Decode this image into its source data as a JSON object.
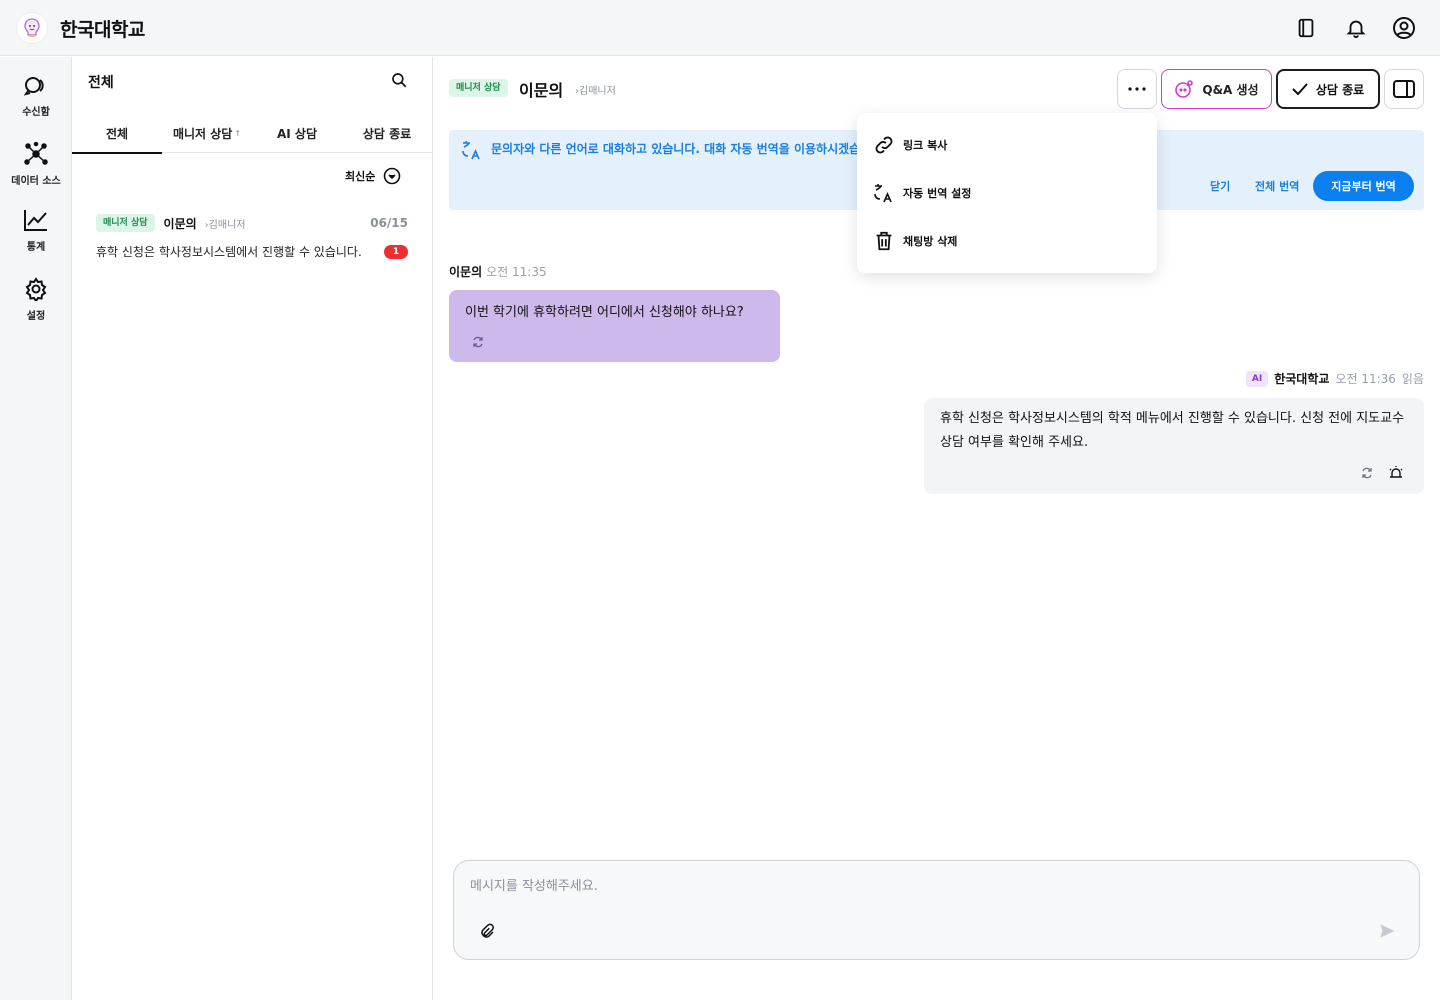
{
  "app": {
    "brand": "한국대학교",
    "accent_color": "#0a7ff0",
    "top_icons": [
      "book-icon",
      "bell-icon",
      "user-circle-icon"
    ]
  },
  "rail": {
    "items": [
      {
        "label": "수신함",
        "icon": "inbox-chat-icon"
      },
      {
        "label": "데이터 소스",
        "icon": "network-icon"
      },
      {
        "label": "통계",
        "icon": "chart-line-icon"
      },
      {
        "label": "설정",
        "icon": "gear-icon"
      }
    ]
  },
  "list": {
    "title": "전체",
    "tabs": [
      {
        "label": "전체",
        "active": true
      },
      {
        "label": "매니저 상담",
        "sort_arrow": "↑"
      },
      {
        "label": "AI 상담"
      },
      {
        "label": "상담 종료"
      }
    ],
    "sort_label": "최신순",
    "conversations": [
      {
        "badge": "매니저 상담",
        "name": "이문의",
        "manager": "김매니저",
        "date": "06/15",
        "preview": "휴학 신청은 학사정보시스템에서 진행할 수 있습니다.",
        "unread": "1"
      }
    ]
  },
  "chat": {
    "badge": "매니저 상담",
    "name": "이문의",
    "manager": "김매니저",
    "qa_button": "Q&A 생성",
    "end_button": "상담 종료",
    "banner": {
      "text": "문의자와 다른 언어로 대화하고 있습니다. 대화 자동 번역을 이용하시겠습",
      "close": "닫기",
      "translate_all": "전체 번역",
      "translate_now": "지금부터 번역"
    },
    "menu": [
      {
        "label": "링크 복사",
        "icon": "link-icon"
      },
      {
        "label": "자동 번역 설정",
        "icon": "translate-icon"
      },
      {
        "label": "채팅방 삭제",
        "icon": "trash-icon"
      }
    ],
    "messages": [
      {
        "sender": "이문의",
        "time": "오전 11:35",
        "text": "이번 학기에 휴학하려면 어디에서 신청해야 하나요?"
      },
      {
        "badge": "AI",
        "sender": "한국대학교",
        "time": "오전 11:36",
        "read": "읽음",
        "text": "휴학 신청은 학사정보시스템의 학적 메뉴에서 진행할 수 있습니다. 신청 전에 지도교수 상담 여부를 확인해 주세요."
      }
    ],
    "composer": {
      "placeholder": "메시지를 작성해주세요."
    }
  }
}
